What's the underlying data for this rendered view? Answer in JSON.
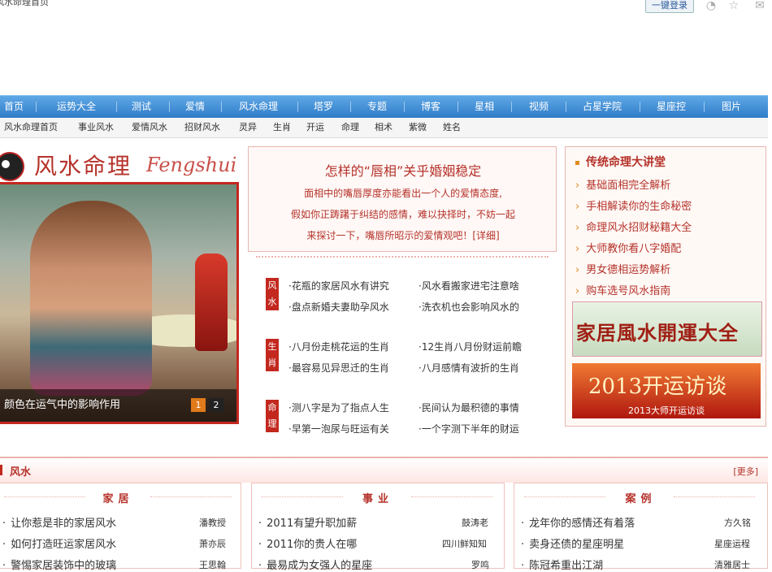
{
  "topbar": {
    "site_text": "风水命理首页",
    "login": "一键登录"
  },
  "nav": [
    "首页",
    "运势大全",
    "测试",
    "爱情",
    "风水命理",
    "塔罗",
    "专题",
    "博客",
    "星相",
    "视频",
    "占星学院",
    "星座控",
    "图片"
  ],
  "subnav": [
    "风水命理首页",
    "事业风水",
    "爱情风水",
    "招财风水",
    "灵异",
    "生肖",
    "开运",
    "命理",
    "相术",
    "紫微",
    "姓名"
  ],
  "logo": {
    "cn": "风水命理",
    "en": "Fengshui"
  },
  "photo": {
    "caption": "颜色在运气中的影响作用",
    "pages": [
      "1",
      "2"
    ]
  },
  "feature": {
    "title": "怎样的“唇相”关乎婚姻稳定",
    "lines": [
      "面相中的嘴唇厚度亦能看出一个人的爱情态度,",
      "假如你正踌躇于纠结的感情，难以抉择时，不妨一起",
      "来探讨一下，嘴唇所昭示的爱情观吧！[详细]"
    ]
  },
  "categories": [
    {
      "label": "风水",
      "rows": [
        [
          "·花瓶的家居风水有讲究",
          "·风水看搬家进宅注意啥"
        ],
        [
          "·盘点新婚夫妻助孕风水",
          "·洗衣机也会影响风水的"
        ]
      ]
    },
    {
      "label": "生肖",
      "rows": [
        [
          "·八月份走桃花运的生肖",
          "·12生肖八月份财运前瞻"
        ],
        [
          "·最容易见异思迁的生肖",
          "·八月感情有波折的生肖"
        ]
      ]
    },
    {
      "label": "命理",
      "rows": [
        [
          "·测八字是为了指点人生",
          "·民间认为最积德的事情"
        ],
        [
          "·早第一泡尿与旺运有关",
          "·一个字测下半年的财运"
        ]
      ]
    }
  ],
  "right": {
    "heading": "传统命理大讲堂",
    "items": [
      "基础面相完全解析",
      "手相解读你的生命秘密",
      "命理风水招财秘籍大全",
      "大师教你看八字婚配",
      "男女德相运势解析",
      "购车选号风水指南"
    ],
    "banner1": "家居風水開運大全",
    "banner2_title": "2013开运访谈",
    "banner2_caption": "2013大师开运访谈"
  },
  "section": {
    "title": "风水",
    "more": "[更多]"
  },
  "columns": [
    {
      "heading": "家居",
      "items": [
        {
          "t": "让你惹是非的家居风水",
          "a": "潘教授"
        },
        {
          "t": "如何打造旺运家居风水",
          "a": "萧亦辰"
        },
        {
          "t": "警惕家居装饰中的玻璃",
          "a": "王思翰"
        }
      ]
    },
    {
      "heading": "事业",
      "items": [
        {
          "t": "2011有望升职加薪",
          "a": "鼓涛老"
        },
        {
          "t": "2011你的贵人在哪",
          "a": "四川鲜知知"
        },
        {
          "t": "最易成为女强人的星座",
          "a": "罗鸣"
        }
      ]
    },
    {
      "heading": "案例",
      "items": [
        {
          "t": "龙年你的感情还有着落",
          "a": "方久铭"
        },
        {
          "t": "卖身还债的星座明星",
          "a": "星座运程"
        },
        {
          "t": "陈冠希重出江湖",
          "a": "清雅居士"
        }
      ]
    }
  ],
  "colors": {
    "accent": "#b5322a",
    "nav": "#2f7cc8"
  }
}
